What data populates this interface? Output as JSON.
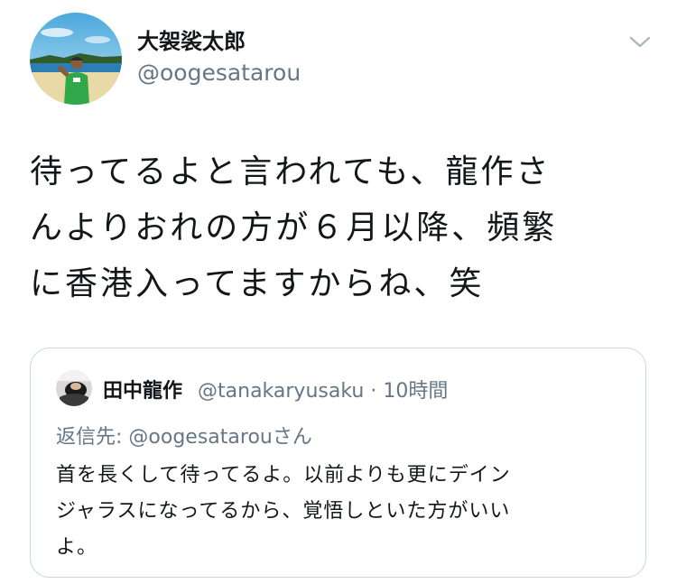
{
  "author": {
    "display_name": "大袈裟太郎",
    "handle": "@oogesatarou"
  },
  "tweet": {
    "lines": [
      "待ってるよと言われても、龍作さ",
      "んよりおれの方が６月以降、頻繁",
      "に香港入ってますからね、笑"
    ]
  },
  "quoted_tweet": {
    "display_name": "田中龍作",
    "handle": "@tanakaryusaku",
    "separator": "·",
    "time": "10時間",
    "reply_prefix": "返信先: ",
    "reply_handle": "@oogesatarou",
    "reply_suffix": "さん",
    "lines": [
      "首を長くして待ってるよ。以前よりも更にデイン",
      "ジャラスになってるから、覚悟しといた方がいい",
      "よ。"
    ]
  },
  "icons": {
    "menu": "chevron-down-icon",
    "avatar": "profile-photo",
    "quoted_avatar": "profile-photo"
  },
  "colors": {
    "text": "#14171a",
    "secondary": "#657786",
    "border": "#ccd6dd"
  }
}
